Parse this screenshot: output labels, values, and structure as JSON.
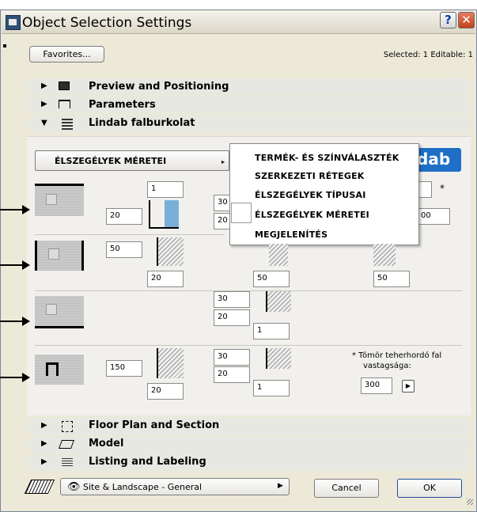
{
  "window": {
    "title": "Object Selection Settings",
    "help_label": "?",
    "close_label": "✕"
  },
  "toolbar": {
    "favorites_label": "Favorites...",
    "selected_info": "Selected: 1 Editable: 1"
  },
  "sections_top": [
    {
      "label": "Preview and Positioning",
      "icon": "preview-icon"
    },
    {
      "label": "Parameters",
      "icon": "parameters-icon"
    },
    {
      "label": "Lindab falburkolat",
      "icon": "lindab-icon"
    }
  ],
  "parameter_panel": {
    "dropdown_label": "ÉLSZEGÉLYEK MÉRETEI",
    "brand_label": "dab",
    "menu_items": [
      "TERMÉK- ÉS SZÍNVÁLASZTÉK",
      "SZERKEZETI RÉTEGEK",
      "ÉLSZEGÉLYEK TÍPUSAI",
      "ÉLSZEGÉLYEK MÉRETEI",
      "MEGJELENÍTÉS"
    ],
    "rows": [
      {
        "a": "1",
        "b": "20",
        "c": "30",
        "d": "20",
        "e": "",
        "f": "00",
        "star": "*"
      },
      {
        "a": "50",
        "b": "20",
        "c": "50",
        "d": "50"
      },
      {
        "a": "30",
        "b": "20",
        "c": "1"
      },
      {
        "a": "150",
        "b": "20",
        "c": "30",
        "d": "20",
        "e": "1"
      }
    ],
    "note_line1": "* Tömör teherhordó fal",
    "note_line2": "vastagsága:",
    "thickness_value": "300",
    "stepper_icon": "play-icon"
  },
  "sections_bottom": [
    {
      "label": "Floor Plan and Section",
      "icon": "floorplan-icon"
    },
    {
      "label": "Model",
      "icon": "model-icon"
    },
    {
      "label": "Listing and Labeling",
      "icon": "listing-icon"
    }
  ],
  "footer": {
    "layer_label": "Site & Landscape - General",
    "cancel_label": "Cancel",
    "ok_label": "OK"
  },
  "colors": {
    "accent_blue": "#1f6fc7",
    "window_bg": "#ece9d8",
    "close_red": "#c2401e"
  }
}
